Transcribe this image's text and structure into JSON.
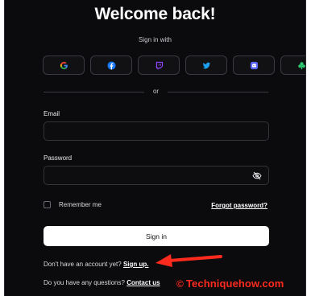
{
  "title": "Welcome back!",
  "signin_with": "Sign in with",
  "social": [
    {
      "name": "google-icon",
      "color": "#ea4335"
    },
    {
      "name": "facebook-icon",
      "color": "#1877f2"
    },
    {
      "name": "twitch-icon",
      "color": "#9146ff"
    },
    {
      "name": "twitter-icon",
      "color": "#1da1f2"
    },
    {
      "name": "discord-icon",
      "color": "#5865f2"
    },
    {
      "name": "guilded-icon",
      "color": "#2ecc71"
    }
  ],
  "or_text": "or",
  "email": {
    "label": "Email",
    "value": "",
    "placeholder": ""
  },
  "password": {
    "label": "Password",
    "value": "",
    "placeholder": ""
  },
  "remember_label": "Remember me",
  "forgot_label": "Forgot password?",
  "signin_label": "Sign in",
  "signup": {
    "prefix": "Don't have an account yet?",
    "link": "Sign up."
  },
  "contact": {
    "prefix": "Do you have any questions?",
    "link": "Contact us"
  },
  "watermark": {
    "symbol": "©",
    "text": "Techniquehow.com"
  },
  "colors": {
    "background": "#0b0b0d",
    "button": "#ffffff",
    "annotation": "#ff2a1e"
  }
}
